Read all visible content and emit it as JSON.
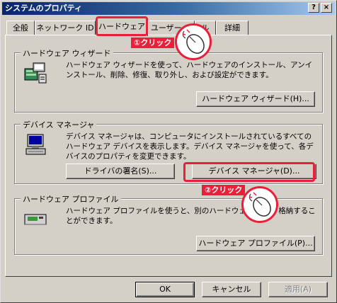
{
  "window": {
    "title": "システムのプロパティ",
    "help_glyph": "?",
    "close_glyph": "×"
  },
  "tabs": [
    {
      "label": "全般"
    },
    {
      "label": "ネットワーク ID"
    },
    {
      "label": "ハードウェア",
      "active": true
    },
    {
      "label": "ユーザー プ"
    },
    {
      "label": "ル"
    },
    {
      "label": "詳細"
    }
  ],
  "wizard": {
    "title": "ハードウェア ウィザード",
    "description": "ハードウェア ウィザードを使って、ハードウェアのインストール、アンインストール、削除、修復、取り外し、および設定ができます。",
    "button": "ハードウェア ウィザード(H)..."
  },
  "device_manager": {
    "title": "デバイス マネージャ",
    "description": "デバイス マネージャは、コンピュータにインストールされているすべてのハードウェア デバイスを表示します。デバイス マネージャを使って、各デバイスのプロパティを変更できます。",
    "driver_signing_button": "ドライバの署名(S)...",
    "device_manager_button": "デバイス マネージャ(D)..."
  },
  "profiles": {
    "title": "ハードウェア プロファイル",
    "description": "ハードウェア プロファイルを使うと、別のハードウェアの構成 格納することができます。",
    "button": "ハードウェア プロファイル(P)..."
  },
  "footer": {
    "ok": "OK",
    "cancel": "キャンセル",
    "apply": "適用(A)"
  },
  "annotations": {
    "step1": "①クリック",
    "step2": "②クリック",
    "highlight_color": "#e8203a"
  }
}
